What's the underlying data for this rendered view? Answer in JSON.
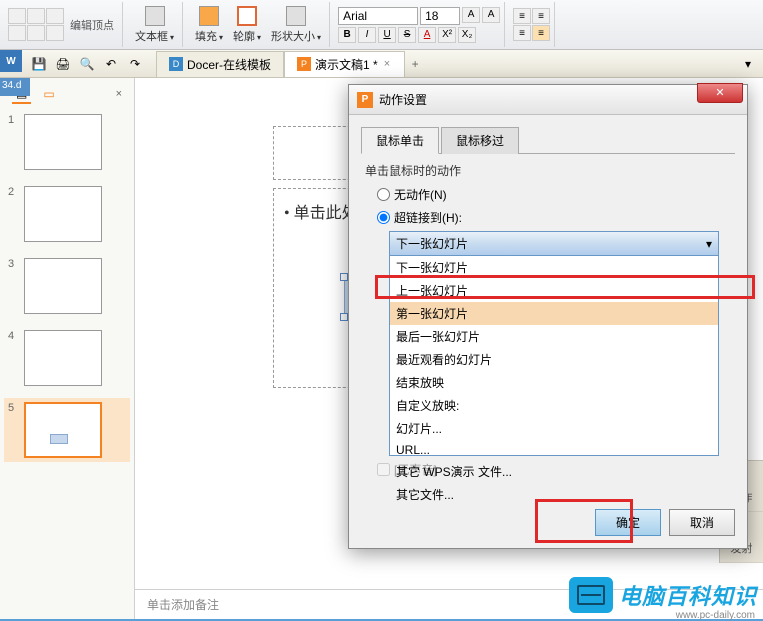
{
  "ribbon": {
    "edit_vertex": "编辑顶点",
    "textbox": "文本框",
    "fill": "填充",
    "outline": "轮廓",
    "shape_size": "形状大小",
    "font_name": "Arial",
    "font_size": "18",
    "bold": "B",
    "italic": "I",
    "underline": "U",
    "strike": "S",
    "font_color": "A",
    "superscript": "X²",
    "subscript": "X₂"
  },
  "qa": {
    "tabs": [
      {
        "icon": "D",
        "label": "Docer-在线模板"
      },
      {
        "icon": "P",
        "label": "演示文稿1 *"
      }
    ],
    "add": "+"
  },
  "file_strip": "34.d",
  "thumbs": {
    "items": [
      1,
      2,
      3,
      4,
      5
    ],
    "selected": 5
  },
  "slide": {
    "title_partial": "单击此",
    "content_partial": "单击此处添加文"
  },
  "notes": "单击添加备注",
  "right_pane": {
    "collab": "协作",
    "publish": "发射"
  },
  "dialog": {
    "title": "动作设置",
    "tabs": {
      "click": "鼠标单击",
      "hover": "鼠标移过"
    },
    "group_label": "单击鼠标时的动作",
    "radio_none": "无动作(N)",
    "radio_hyperlink": "超链接到(H):",
    "combo_selected": "下一张幻灯片",
    "combo_items": [
      "下一张幻灯片",
      "上一张幻灯片",
      "第一张幻灯片",
      "最后一张幻灯片",
      "最近观看的幻灯片",
      "结束放映",
      "自定义放映:",
      "幻灯片...",
      "URL...",
      "其它 WPS演示 文件...",
      "其它文件..."
    ],
    "highlight_index": 2,
    "sound_disabled": "[无声音]",
    "ok": "确定",
    "cancel": "取消"
  },
  "watermark": {
    "text": "电脑百科知识",
    "url": "www.pc-daily.com"
  }
}
